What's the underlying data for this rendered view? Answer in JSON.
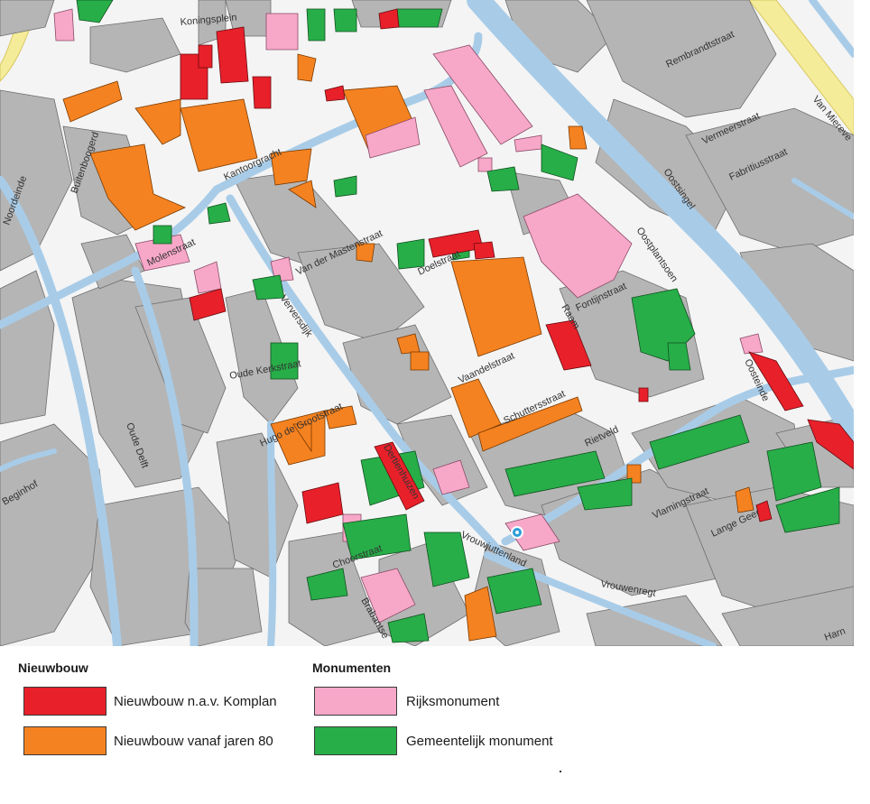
{
  "colors": {
    "komplan": "#e8202a",
    "jaren80": "#f58220",
    "rijksmonument": "#f7a8c8",
    "gemeentelijk": "#27ae48",
    "water": "#a8cce8",
    "building": "#b5b5b5",
    "highway": "#f5ec9a"
  },
  "streets": {
    "koningsplein": "Koningsplein",
    "buitenboogerd": "Buitenboogerd",
    "noordeinde": "Noordeinde",
    "kantoorgracht": "Kantoorgracht",
    "molenstraat": "Molenstraat",
    "van_der_mastenstraat": "Van der Mastenstraat",
    "doelstraat": "Doelstraat",
    "verversdijk": "Verversdijk",
    "oude_delft": "Oude Delft",
    "fontijnstraat": "Fontijnstraat",
    "oostplantsoen": "Oostplantsoen",
    "oostsingel": "Oostsingel",
    "raam": "Raam",
    "vaandelstraat": "Vaandelstraat",
    "schuttersstraat": "Schuttersstraat",
    "rietveld": "Rietveld",
    "oosteinde": "Oosteinde",
    "vlamingstraat": "Vlamingstraat",
    "lange_geer": "Lange Geer",
    "vrouwenregt": "Vrouwenregt",
    "vrouwjuttenland": "Vrouwjuttenland",
    "choorstraat": "Choorstraat",
    "oude_kerkstraat": "Oude Kerkstraat",
    "dertienhuizen": "Dertienhuizen",
    "hugo_de_grootstraat": "Hugo de Grootstraat",
    "beginhof": "Beginhof",
    "brabantse": "Brabantse",
    "vermeerstraat": "Vermeerstraat",
    "fabritiusstraat": "Fabritiusstraat",
    "rembrandtstraat": "Rembrandtstraat",
    "van_miereveld": "Van Miereve",
    "harn": "Harn"
  },
  "legend": {
    "nieuwbouw_heading": "Nieuwbouw",
    "monumenten_heading": "Monumenten",
    "komplan_label": "Nieuwbouw n.a.v. Komplan",
    "jaren80_label": "Nieuwbouw vanaf jaren 80",
    "rijksmonument_label": "Rijksmonument",
    "gemeentelijk_label": "Gemeentelijk monument"
  }
}
